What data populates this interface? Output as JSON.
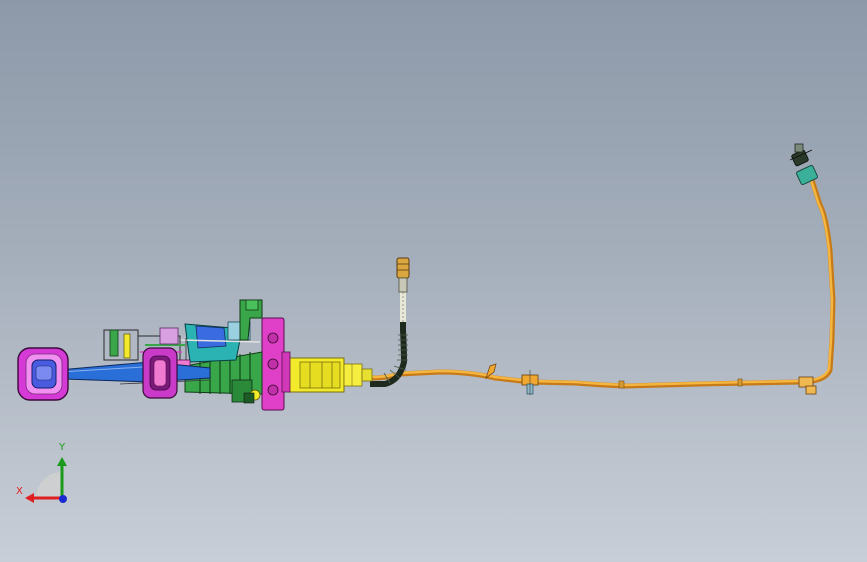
{
  "viewport": {
    "background_top": "#8d99a9",
    "background_bottom": "#c8ced7"
  },
  "model": {
    "parts": [
      {
        "name": "handle-grip",
        "color": "#d63ad6"
      },
      {
        "name": "handle-insert",
        "color": "#4a5be0"
      },
      {
        "name": "shift-rod",
        "color": "#2a6fd8"
      },
      {
        "name": "lever-ring",
        "color": "#c93ac9"
      },
      {
        "name": "housing-bracket",
        "color": "#2bb3b3"
      },
      {
        "name": "gear-cluster",
        "color": "#3aa64a"
      },
      {
        "name": "mounting-flange",
        "color": "#e040c8"
      },
      {
        "name": "cable-coupler",
        "color": "#f2ea2a"
      },
      {
        "name": "flexible-hose",
        "color": "#1e2a1e"
      },
      {
        "name": "brass-fitting",
        "color": "#d9a640"
      },
      {
        "name": "cable-line",
        "color": "#f0a830"
      },
      {
        "name": "end-connector",
        "color": "#3ab09a"
      }
    ]
  },
  "triad": {
    "x_label": "X",
    "y_label": "Y",
    "x_color": "#e02020",
    "y_color": "#1a9a1a",
    "z_color": "#1a2ad0"
  }
}
